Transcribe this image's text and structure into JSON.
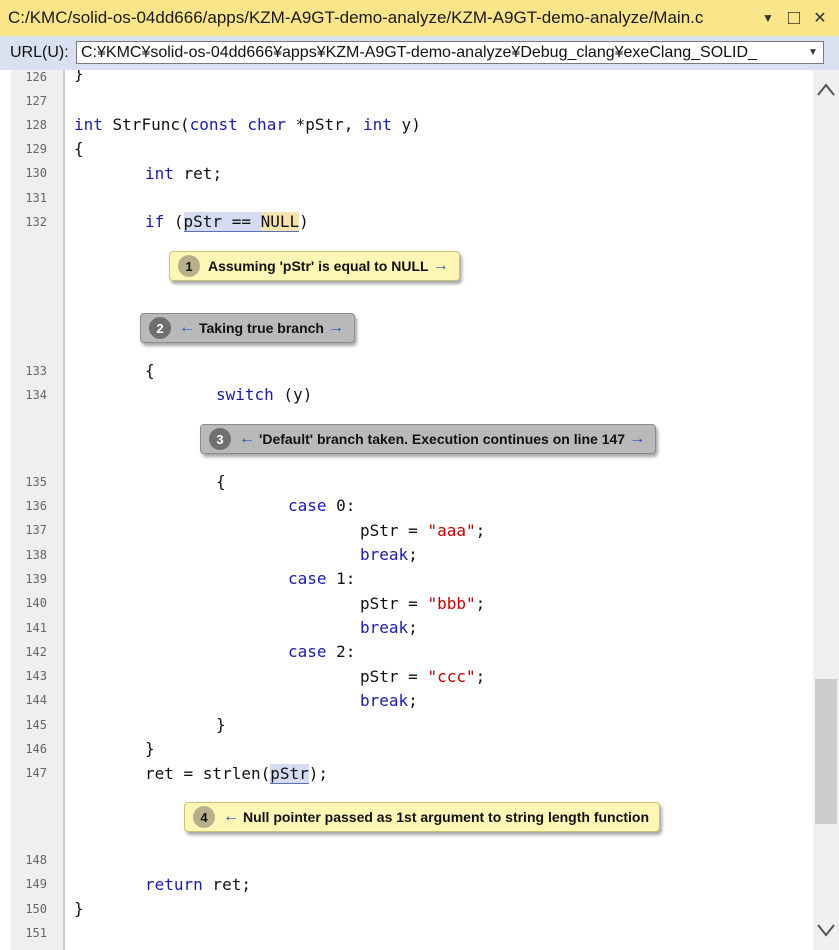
{
  "window": {
    "title": "C:/KMC/solid-os-04dd666/apps/KZM-A9GT-demo-analyze/KZM-A9GT-demo-analyze/Main.c",
    "menu_glyph": "▼",
    "restore_glyph": "□",
    "close_glyph": "✕"
  },
  "urlbar": {
    "label": "URL(U):",
    "value": "C:¥KMC¥solid-os-04dd666¥apps¥KZM-A9GT-demo-analyze¥Debug_clang¥exeClang_SOLID_",
    "arrow": "▼"
  },
  "lines": {
    "l126": {
      "num": "126",
      "text": "}"
    },
    "l127": {
      "num": "127"
    },
    "l128": {
      "num": "128",
      "kw_int": "int",
      "name": " StrFunc(",
      "kw_const": "const",
      "sp": " ",
      "kw_char": "char",
      "rest": " *pStr, ",
      "kw_int2": "int",
      "end": " y)"
    },
    "l129": {
      "num": "129",
      "text": "{"
    },
    "l130": {
      "num": "130",
      "kw": "int",
      "rest": " ret;"
    },
    "l131": {
      "num": "131"
    },
    "l132": {
      "num": "132",
      "kw": "if",
      "open": " (",
      "hl1": "pStr == ",
      "hl2": "NULL",
      "close": ")"
    },
    "l133": {
      "num": "133",
      "text": "{"
    },
    "l134": {
      "num": "134",
      "kw": "switch",
      "rest": " (y)"
    },
    "l135": {
      "num": "135",
      "text": "{"
    },
    "l136": {
      "num": "136",
      "kw": "case",
      "rest": " 0:"
    },
    "l137": {
      "num": "137",
      "pre": "pStr = ",
      "str": "\"aaa\"",
      "post": ";"
    },
    "l138": {
      "num": "138",
      "kw": "break",
      "rest": ";"
    },
    "l139": {
      "num": "139",
      "kw": "case",
      "rest": " 1:"
    },
    "l140": {
      "num": "140",
      "pre": "pStr = ",
      "str": "\"bbb\"",
      "post": ";"
    },
    "l141": {
      "num": "141",
      "kw": "break",
      "rest": ";"
    },
    "l142": {
      "num": "142",
      "kw": "case",
      "rest": " 2:"
    },
    "l143": {
      "num": "143",
      "pre": "pStr = ",
      "str": "\"ccc\"",
      "post": ";"
    },
    "l144": {
      "num": "144",
      "kw": "break",
      "rest": ";"
    },
    "l145": {
      "num": "145",
      "text": "}"
    },
    "l146": {
      "num": "146",
      "text": "}"
    },
    "l147": {
      "num": "147",
      "pre": "ret = strlen(",
      "hl": "pStr",
      "post": ");"
    },
    "l148": {
      "num": "148"
    },
    "l149": {
      "num": "149",
      "kw": "return",
      "rest": " ret;"
    },
    "l150": {
      "num": "150",
      "text": "}"
    },
    "l151": {
      "num": "151"
    }
  },
  "annotations": {
    "a1": {
      "num": "1",
      "text": "Assuming 'pStr' is equal to NULL",
      "next": "→"
    },
    "a2": {
      "num": "2",
      "prev": "←",
      "text": "Taking true branch",
      "next": "→"
    },
    "a3": {
      "num": "3",
      "prev": "←",
      "text": "'Default' branch taken. Execution continues on line 147",
      "next": "→"
    },
    "a4": {
      "num": "4",
      "prev": "←",
      "text": "Null pointer passed as 1st argument to string length function"
    }
  }
}
